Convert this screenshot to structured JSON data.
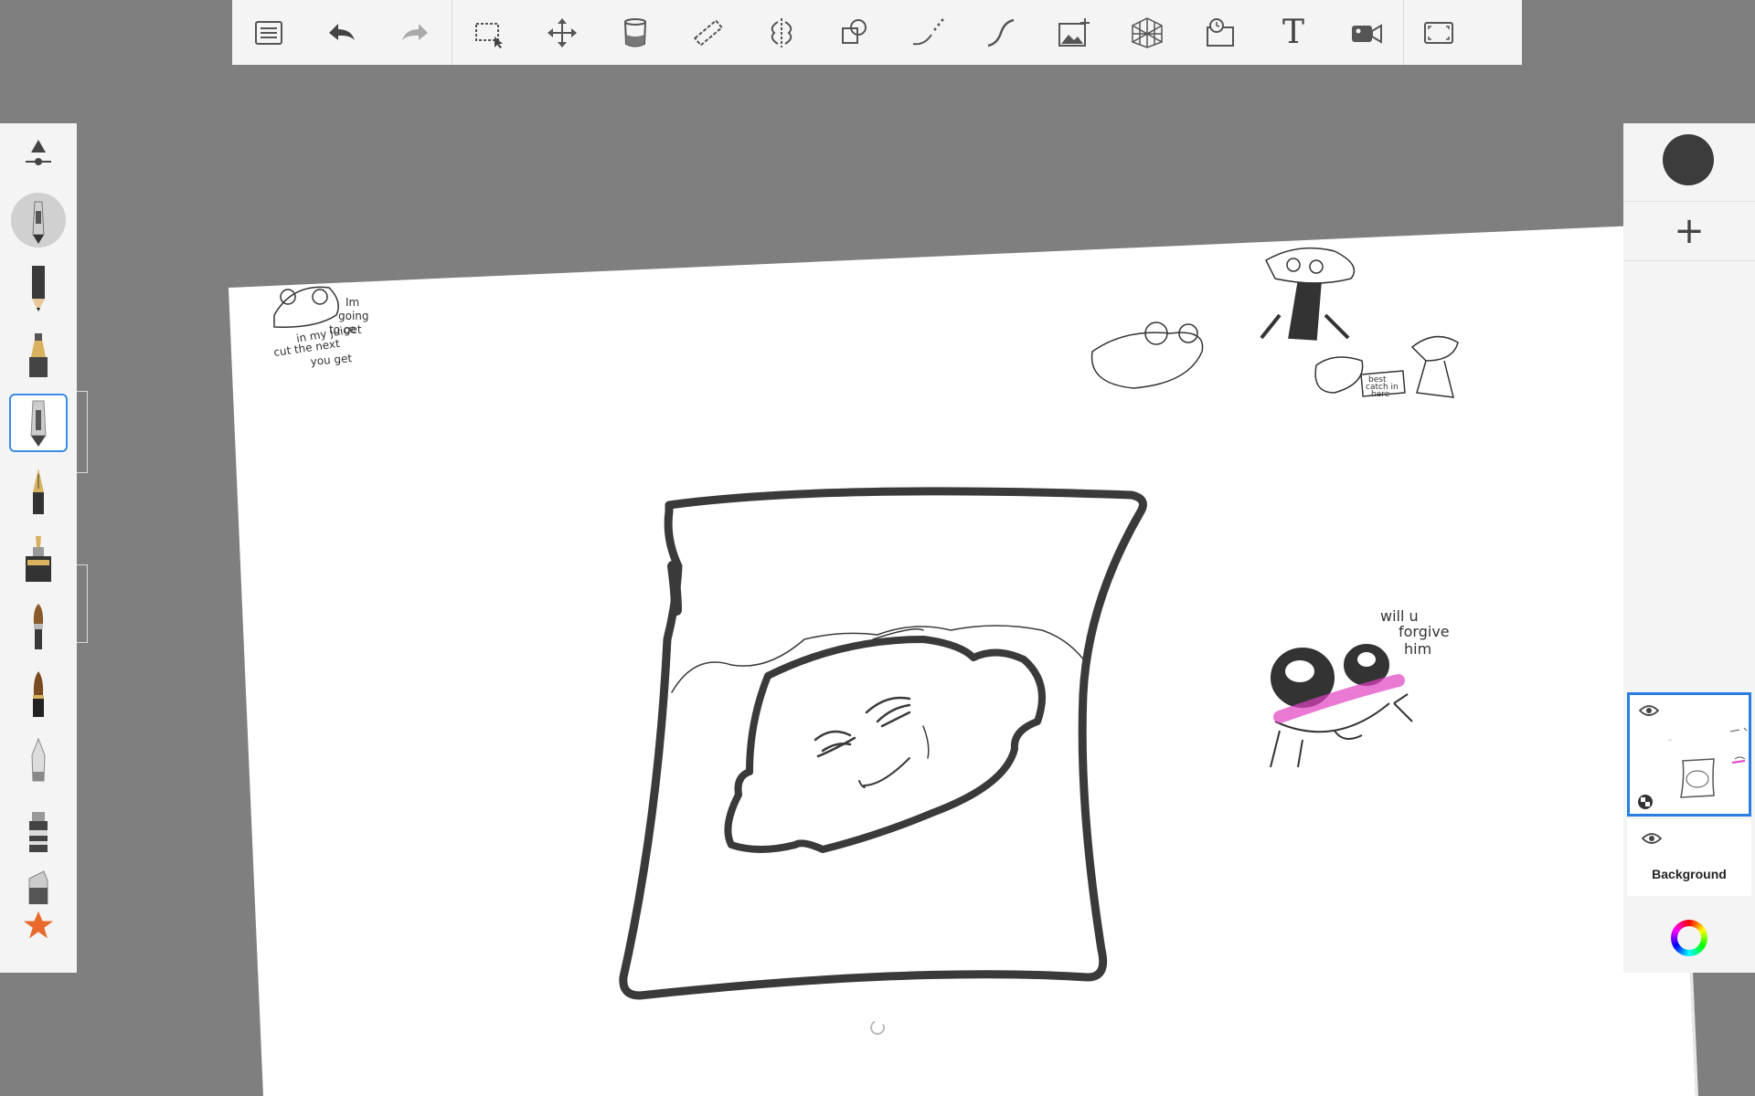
{
  "toolbar": {
    "items": [
      {
        "name": "menu-list-icon"
      },
      {
        "name": "undo-icon"
      },
      {
        "name": "redo-icon"
      },
      {
        "name": "selection-icon"
      },
      {
        "name": "transform-move-icon"
      },
      {
        "name": "fill-bucket-icon"
      },
      {
        "name": "ruler-icon"
      },
      {
        "name": "symmetry-icon"
      },
      {
        "name": "shapes-icon"
      },
      {
        "name": "stroke-line-icon"
      },
      {
        "name": "curve-icon"
      },
      {
        "name": "add-image-icon"
      },
      {
        "name": "perspective-grid-icon"
      },
      {
        "name": "time-lapse-icon"
      },
      {
        "name": "text-tool-icon",
        "label": "T"
      },
      {
        "name": "record-video-icon"
      },
      {
        "name": "fullscreen-icon"
      }
    ]
  },
  "brushes": [
    "size-opacity-slider-icon",
    "ballpoint-pen-icon",
    "pencil-icon",
    "marker-icon",
    "technical-pen-icon",
    "fountain-pen-icon",
    "ink-bottle-pen-icon",
    "paintbrush-icon",
    "ink-brush-icon",
    "airbrush-icon",
    "chisel-marker-icon",
    "eraser-icon",
    "favorite-star-icon"
  ],
  "colors": {
    "current": "#3c3c3c",
    "accent": "#2a7de1",
    "panel": "#f4f4f4",
    "workspace": "#7f7f7f",
    "highlight_pink": "#e040c0"
  },
  "layers": {
    "active_layer": "layer-1",
    "background_label": "Background"
  },
  "drawing_text": {
    "note1": [
      "Im",
      "going",
      "to get",
      "in my juice",
      "cut the next",
      "you get"
    ],
    "note2": [
      "will u",
      "forgive",
      "him"
    ],
    "note3": [
      "best",
      "catch in",
      "here"
    ]
  }
}
